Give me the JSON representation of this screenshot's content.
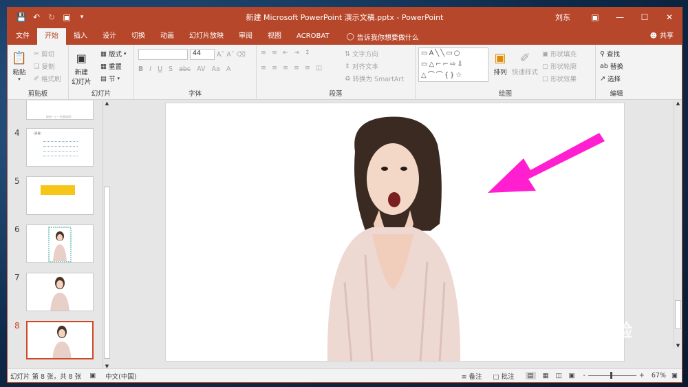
{
  "window": {
    "title": "新建 Microsoft PowerPoint 演示文稿.pptx  -  PowerPoint",
    "user": "刘东",
    "minimize_icon": "minimize-icon",
    "maximize_icon": "maximize-icon",
    "close_icon": "close-icon"
  },
  "tabs": [
    "文件",
    "开始",
    "插入",
    "设计",
    "切换",
    "动画",
    "幻灯片放映",
    "审阅",
    "视图",
    "ACROBAT"
  ],
  "active_tab": "开始",
  "tell_me": "告诉我你想要做什么",
  "share": "共享",
  "ribbon": {
    "clipboard": {
      "label": "剪贴板",
      "paste": "粘贴",
      "cut": "剪切",
      "copy": "复制",
      "format_painter": "格式刷"
    },
    "slides": {
      "label": "幻灯片",
      "new_slide_1": "新建",
      "new_slide_2": "幻灯片",
      "layout": "版式",
      "reset": "重置",
      "section": "节"
    },
    "font": {
      "label": "字体",
      "font_name": "",
      "font_size": "44"
    },
    "paragraph": {
      "label": "段落",
      "text_direction": "文字方向",
      "align_text": "对齐文本",
      "smartart": "转换为 SmartArt"
    },
    "drawing": {
      "label": "绘图",
      "arrange": "排列",
      "quick_styles": "快速样式",
      "shape_fill": "形状填充",
      "shape_outline": "形状轮廓",
      "shape_effects": "形状效果"
    },
    "editing": {
      "label": "编辑",
      "find": "查找",
      "replace": "替换",
      "select": "选择"
    }
  },
  "slides": [
    {
      "number": "",
      "caption": "按你一上一的表格表！"
    },
    {
      "number": "4",
      "caption": "(表格)"
    },
    {
      "number": "5"
    },
    {
      "number": "6"
    },
    {
      "number": "7"
    },
    {
      "number": "8"
    }
  ],
  "selected_slide": "8",
  "status": {
    "slide_info": "幻灯片 第 8 张，共 8 张",
    "language": "中文(中国)",
    "notes": "备注",
    "comments": "批注",
    "zoom": "67%",
    "zoom_minus": "-",
    "zoom_plus": "+"
  },
  "watermark": {
    "brand": "Baidu",
    "brand_cn": "经验",
    "url": "jingyan.baidu.com"
  },
  "colors": {
    "accent": "#b7472a",
    "arrow": "#ff1fd0",
    "selected": "#d24726"
  }
}
